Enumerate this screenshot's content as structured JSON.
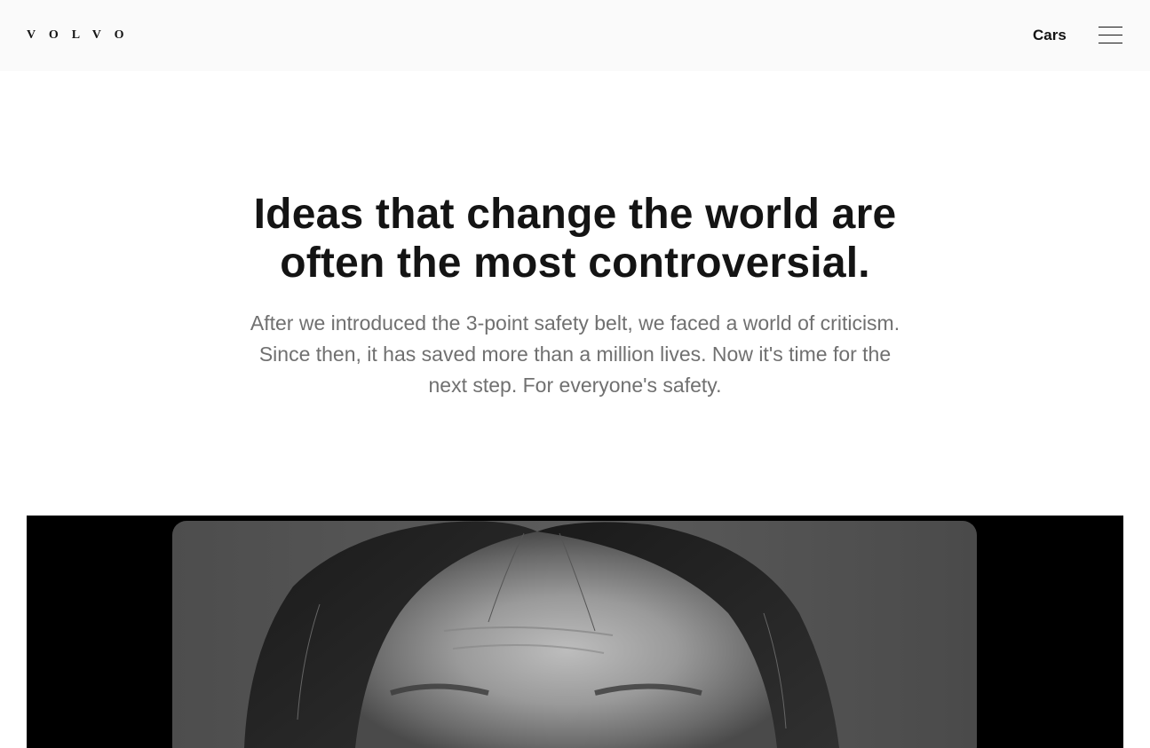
{
  "header": {
    "logo_text": "VOLVO",
    "nav_cars_label": "Cars",
    "menu_icon": "hamburger-menu-icon"
  },
  "hero": {
    "heading": "Ideas that change the world are often the most controversial.",
    "body": "After we introduced the 3-point safety belt, we faced a world of criticism. Since then, it has saved more than a million lives. Now it's time for the next step. For everyone's safety."
  },
  "media": {
    "description_icon": "video-frame"
  },
  "colors": {
    "header_bg": "#fafafa",
    "text_primary": "#141414",
    "text_secondary": "#707070",
    "media_bg": "#000000"
  }
}
